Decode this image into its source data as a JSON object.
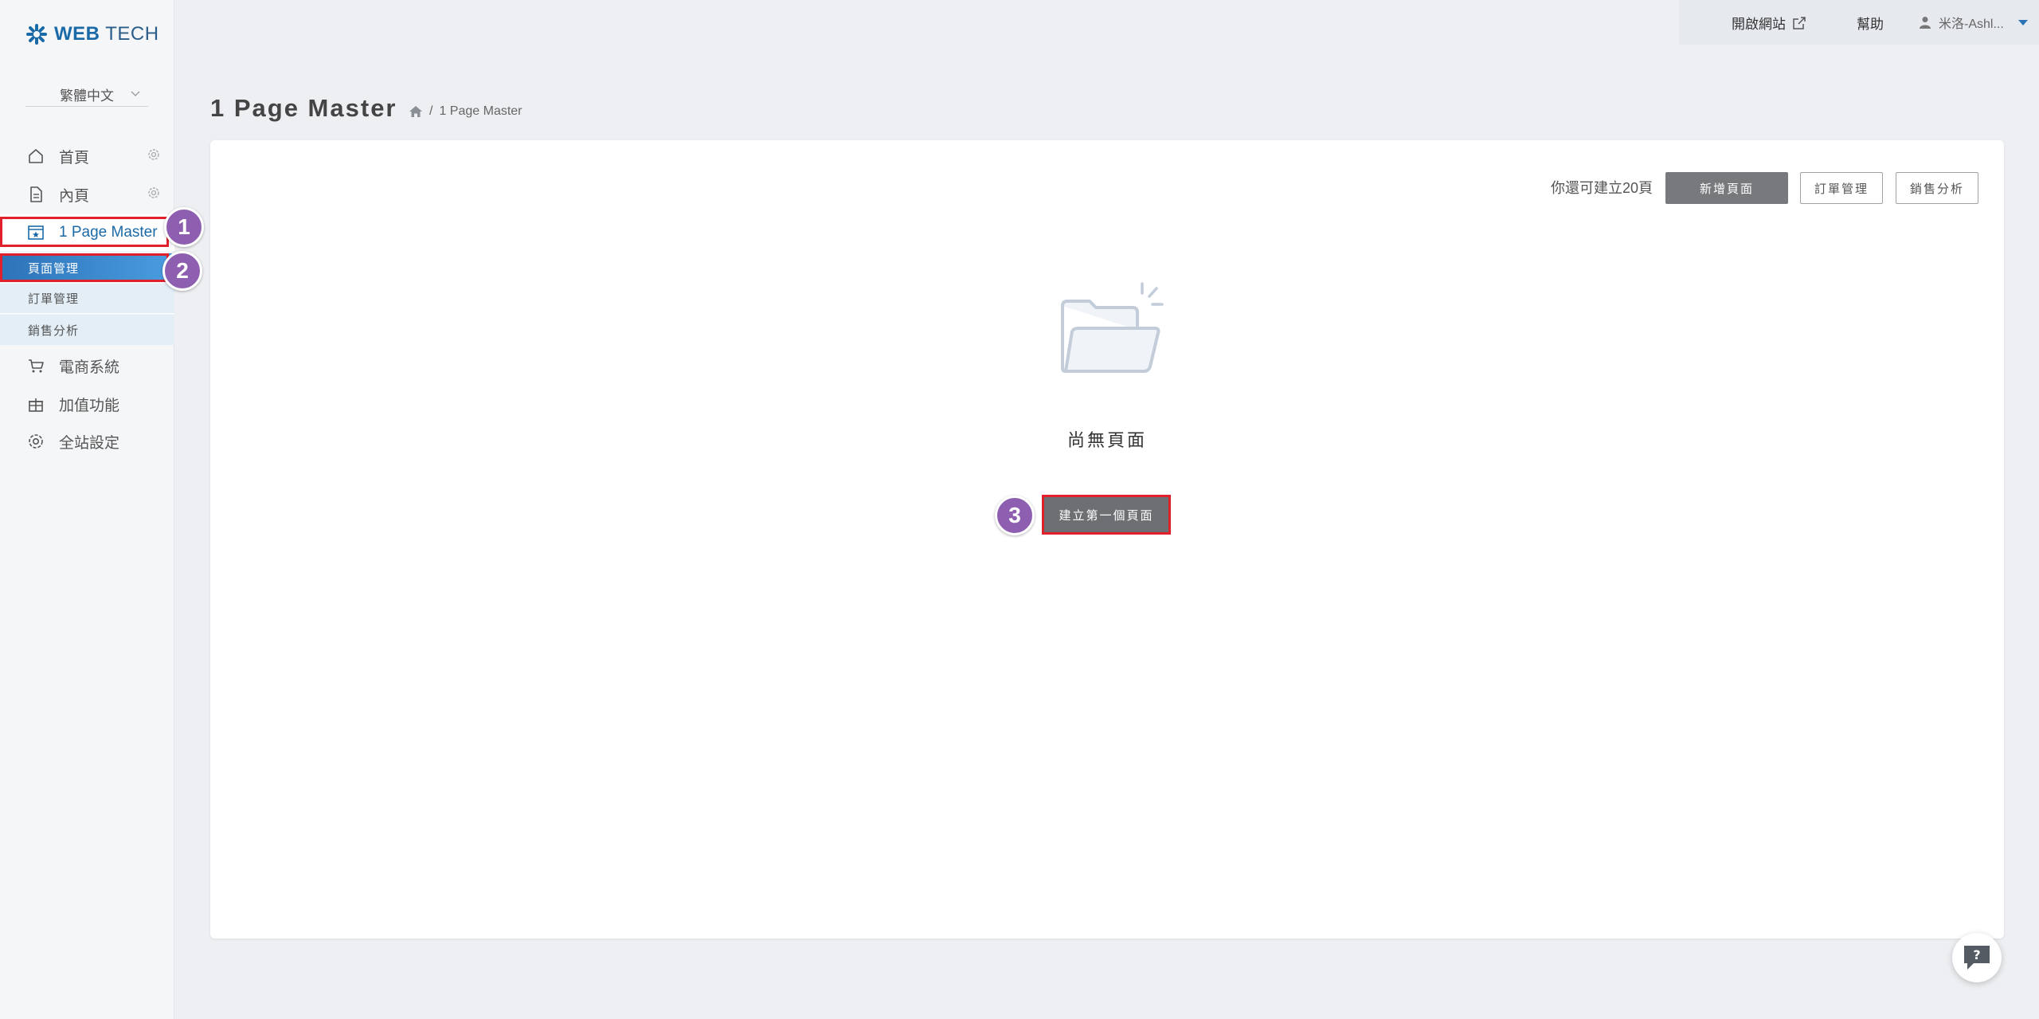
{
  "brand": {
    "bold": "WEB",
    "light": "TECH"
  },
  "language": {
    "selected": "繁體中文"
  },
  "sidebar": {
    "items": [
      {
        "label": "首頁"
      },
      {
        "label": "內頁"
      },
      {
        "label": "1 Page Master"
      },
      {
        "label": "電商系統"
      },
      {
        "label": "加值功能"
      },
      {
        "label": "全站設定"
      }
    ],
    "sub_items": [
      {
        "label": "頁面管理"
      },
      {
        "label": "訂單管理"
      },
      {
        "label": "銷售分析"
      }
    ]
  },
  "topbar": {
    "open_site": "開啟網站",
    "help": "幫助",
    "user": "米洛-Ashl..."
  },
  "page": {
    "title": "1 Page Master",
    "breadcrumb_sep": "/",
    "breadcrumb_current": "1 Page Master"
  },
  "panel": {
    "quota_text": "你還可建立20頁",
    "add_page": "新增頁面",
    "order_mgmt": "訂單管理",
    "sales_analysis": "銷售分析",
    "empty_text": "尚無頁面",
    "create_first": "建立第一個頁面"
  },
  "annotations": {
    "one": "1",
    "two": "2",
    "three": "3"
  },
  "colors": {
    "accent": "#1b6aa8",
    "highlight": "#e0212b",
    "badge": "#8e5fb0",
    "dark_button": "#77797c"
  }
}
